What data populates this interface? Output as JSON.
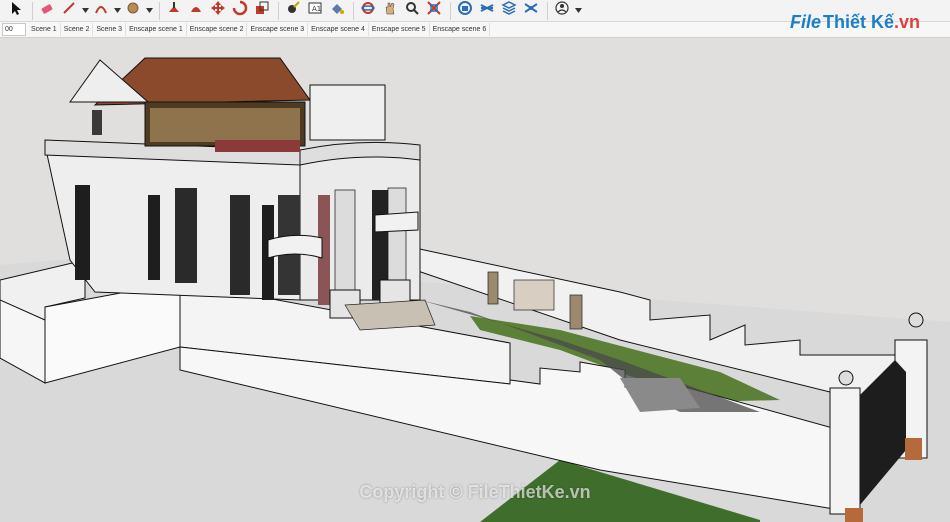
{
  "toolbar": {
    "tools": [
      {
        "name": "select-tool-icon",
        "caret": false
      },
      {
        "name": "eraser-tool-icon",
        "caret": false
      },
      {
        "name": "line-tool-icon",
        "caret": true
      },
      {
        "name": "arc-tool-icon",
        "caret": true
      },
      {
        "name": "shape-tool-icon",
        "caret": true
      },
      {
        "name": "pushpull-tool-icon",
        "caret": false
      },
      {
        "name": "followme-tool-icon",
        "caret": false
      },
      {
        "name": "move-tool-icon",
        "caret": false
      },
      {
        "name": "rotate-tool-icon",
        "caret": false
      },
      {
        "name": "scale-tool-icon",
        "caret": false
      },
      {
        "name": "tape-measure-icon",
        "caret": false
      },
      {
        "name": "text-tool-icon",
        "caret": false
      },
      {
        "name": "paint-bucket-icon",
        "caret": false
      },
      {
        "name": "orbit-tool-icon",
        "caret": false
      },
      {
        "name": "pan-tool-icon",
        "caret": false
      },
      {
        "name": "zoom-tool-icon",
        "caret": false
      },
      {
        "name": "zoom-extents-icon",
        "caret": false
      },
      {
        "name": "warehouse-icon",
        "caret": false
      },
      {
        "name": "extension-icon",
        "caret": false
      },
      {
        "name": "layers-icon",
        "caret": false
      },
      {
        "name": "extension-manager-icon",
        "caret": false
      },
      {
        "name": "account-icon",
        "caret": true
      }
    ]
  },
  "coord_field": "00",
  "scenes": [
    "Scene 1",
    "Scene 2",
    "Scene 3",
    "Enscape scene 1",
    "Enscape scene 2",
    "Enscape scene 3",
    "Enscape scene 4",
    "Enscape scene 5",
    "Enscape scene 6"
  ],
  "logo": {
    "file": "File",
    "rest": "Thiết Kế",
    ".vn": ".vn"
  },
  "watermark": "Copyright © FileThietKe.vn",
  "colors": {
    "toolbar_bg": "#f3f3f3",
    "sky": "#e0dfde",
    "roof": "#8b4a2b",
    "wall": "#efefef",
    "grass": "#3f6e2c",
    "logo_blue": "#1a7fc7"
  }
}
